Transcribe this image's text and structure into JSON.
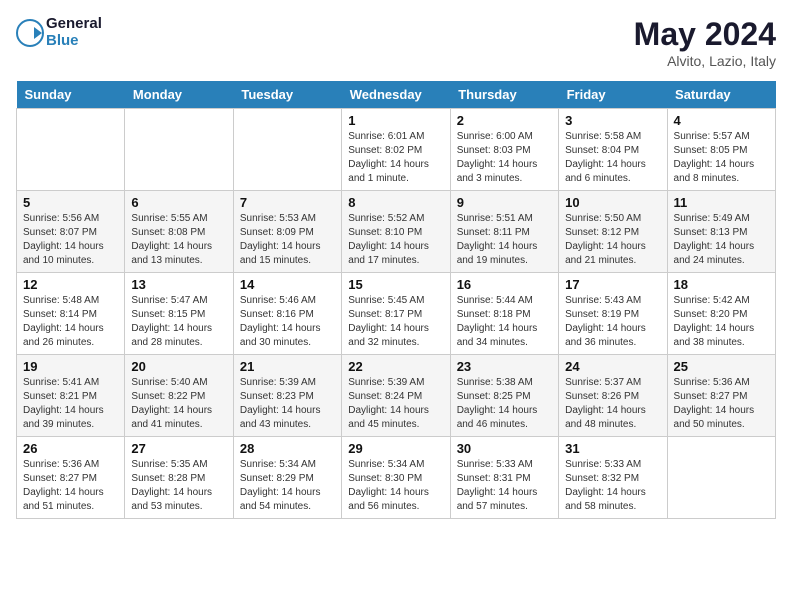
{
  "header": {
    "logo_general": "General",
    "logo_blue": "Blue",
    "month_title": "May 2024",
    "location": "Alvito, Lazio, Italy"
  },
  "weekdays": [
    "Sunday",
    "Monday",
    "Tuesday",
    "Wednesday",
    "Thursday",
    "Friday",
    "Saturday"
  ],
  "weeks": [
    [
      {
        "day": "",
        "info": ""
      },
      {
        "day": "",
        "info": ""
      },
      {
        "day": "",
        "info": ""
      },
      {
        "day": "1",
        "info": "Sunrise: 6:01 AM\nSunset: 8:02 PM\nDaylight: 14 hours\nand 1 minute."
      },
      {
        "day": "2",
        "info": "Sunrise: 6:00 AM\nSunset: 8:03 PM\nDaylight: 14 hours\nand 3 minutes."
      },
      {
        "day": "3",
        "info": "Sunrise: 5:58 AM\nSunset: 8:04 PM\nDaylight: 14 hours\nand 6 minutes."
      },
      {
        "day": "4",
        "info": "Sunrise: 5:57 AM\nSunset: 8:05 PM\nDaylight: 14 hours\nand 8 minutes."
      }
    ],
    [
      {
        "day": "5",
        "info": "Sunrise: 5:56 AM\nSunset: 8:07 PM\nDaylight: 14 hours\nand 10 minutes."
      },
      {
        "day": "6",
        "info": "Sunrise: 5:55 AM\nSunset: 8:08 PM\nDaylight: 14 hours\nand 13 minutes."
      },
      {
        "day": "7",
        "info": "Sunrise: 5:53 AM\nSunset: 8:09 PM\nDaylight: 14 hours\nand 15 minutes."
      },
      {
        "day": "8",
        "info": "Sunrise: 5:52 AM\nSunset: 8:10 PM\nDaylight: 14 hours\nand 17 minutes."
      },
      {
        "day": "9",
        "info": "Sunrise: 5:51 AM\nSunset: 8:11 PM\nDaylight: 14 hours\nand 19 minutes."
      },
      {
        "day": "10",
        "info": "Sunrise: 5:50 AM\nSunset: 8:12 PM\nDaylight: 14 hours\nand 21 minutes."
      },
      {
        "day": "11",
        "info": "Sunrise: 5:49 AM\nSunset: 8:13 PM\nDaylight: 14 hours\nand 24 minutes."
      }
    ],
    [
      {
        "day": "12",
        "info": "Sunrise: 5:48 AM\nSunset: 8:14 PM\nDaylight: 14 hours\nand 26 minutes."
      },
      {
        "day": "13",
        "info": "Sunrise: 5:47 AM\nSunset: 8:15 PM\nDaylight: 14 hours\nand 28 minutes."
      },
      {
        "day": "14",
        "info": "Sunrise: 5:46 AM\nSunset: 8:16 PM\nDaylight: 14 hours\nand 30 minutes."
      },
      {
        "day": "15",
        "info": "Sunrise: 5:45 AM\nSunset: 8:17 PM\nDaylight: 14 hours\nand 32 minutes."
      },
      {
        "day": "16",
        "info": "Sunrise: 5:44 AM\nSunset: 8:18 PM\nDaylight: 14 hours\nand 34 minutes."
      },
      {
        "day": "17",
        "info": "Sunrise: 5:43 AM\nSunset: 8:19 PM\nDaylight: 14 hours\nand 36 minutes."
      },
      {
        "day": "18",
        "info": "Sunrise: 5:42 AM\nSunset: 8:20 PM\nDaylight: 14 hours\nand 38 minutes."
      }
    ],
    [
      {
        "day": "19",
        "info": "Sunrise: 5:41 AM\nSunset: 8:21 PM\nDaylight: 14 hours\nand 39 minutes."
      },
      {
        "day": "20",
        "info": "Sunrise: 5:40 AM\nSunset: 8:22 PM\nDaylight: 14 hours\nand 41 minutes."
      },
      {
        "day": "21",
        "info": "Sunrise: 5:39 AM\nSunset: 8:23 PM\nDaylight: 14 hours\nand 43 minutes."
      },
      {
        "day": "22",
        "info": "Sunrise: 5:39 AM\nSunset: 8:24 PM\nDaylight: 14 hours\nand 45 minutes."
      },
      {
        "day": "23",
        "info": "Sunrise: 5:38 AM\nSunset: 8:25 PM\nDaylight: 14 hours\nand 46 minutes."
      },
      {
        "day": "24",
        "info": "Sunrise: 5:37 AM\nSunset: 8:26 PM\nDaylight: 14 hours\nand 48 minutes."
      },
      {
        "day": "25",
        "info": "Sunrise: 5:36 AM\nSunset: 8:27 PM\nDaylight: 14 hours\nand 50 minutes."
      }
    ],
    [
      {
        "day": "26",
        "info": "Sunrise: 5:36 AM\nSunset: 8:27 PM\nDaylight: 14 hours\nand 51 minutes."
      },
      {
        "day": "27",
        "info": "Sunrise: 5:35 AM\nSunset: 8:28 PM\nDaylight: 14 hours\nand 53 minutes."
      },
      {
        "day": "28",
        "info": "Sunrise: 5:34 AM\nSunset: 8:29 PM\nDaylight: 14 hours\nand 54 minutes."
      },
      {
        "day": "29",
        "info": "Sunrise: 5:34 AM\nSunset: 8:30 PM\nDaylight: 14 hours\nand 56 minutes."
      },
      {
        "day": "30",
        "info": "Sunrise: 5:33 AM\nSunset: 8:31 PM\nDaylight: 14 hours\nand 57 minutes."
      },
      {
        "day": "31",
        "info": "Sunrise: 5:33 AM\nSunset: 8:32 PM\nDaylight: 14 hours\nand 58 minutes."
      },
      {
        "day": "",
        "info": ""
      }
    ]
  ]
}
